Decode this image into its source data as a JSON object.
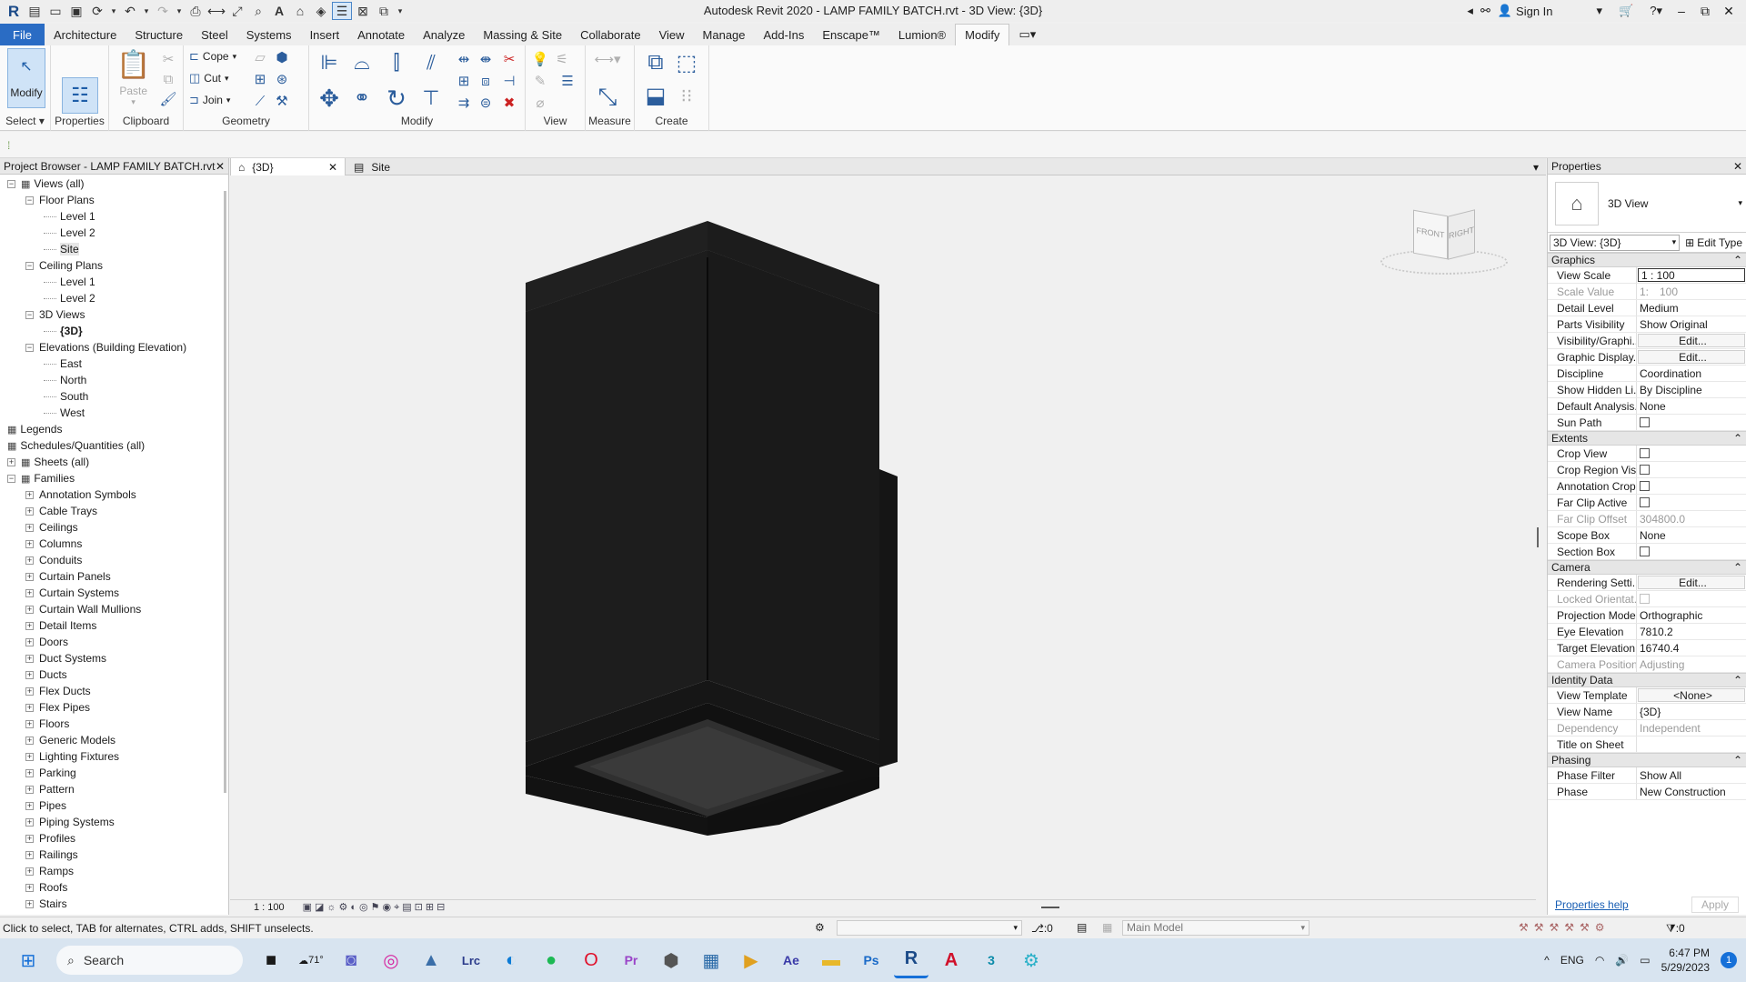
{
  "app": {
    "title": "Autodesk Revit 2020 - LAMP FAMILY BATCH.rvt - 3D View: {3D}",
    "sign_in": "Sign In"
  },
  "menu": [
    "File",
    "Architecture",
    "Structure",
    "Steel",
    "Systems",
    "Insert",
    "Annotate",
    "Analyze",
    "Massing & Site",
    "Collaborate",
    "View",
    "Manage",
    "Add-Ins",
    "Enscape™",
    "Lumion®",
    "Modify"
  ],
  "ribbon": {
    "select": "Select",
    "modify": "Modify",
    "properties": "Properties",
    "paste": "Paste",
    "clipboard": "Clipboard",
    "cope": "Cope",
    "cut": "Cut",
    "join": "Join",
    "geometry": "Geometry",
    "modify_panel": "Modify",
    "view": "View",
    "measure": "Measure",
    "create": "Create"
  },
  "project_browser": {
    "title": "Project Browser - LAMP FAMILY BATCH.rvt",
    "items": [
      {
        "label": "Views (all)",
        "level": 0,
        "toggle": "−",
        "icon": "views-icon"
      },
      {
        "label": "Floor Plans",
        "level": 1,
        "toggle": "−"
      },
      {
        "label": "Level 1",
        "level": 2
      },
      {
        "label": "Level 2",
        "level": 2
      },
      {
        "label": "Site",
        "level": 2,
        "selected": true
      },
      {
        "label": "Ceiling Plans",
        "level": 1,
        "toggle": "−"
      },
      {
        "label": "Level 1",
        "level": 2
      },
      {
        "label": "Level 2",
        "level": 2
      },
      {
        "label": "3D Views",
        "level": 1,
        "toggle": "−"
      },
      {
        "label": "{3D}",
        "level": 2,
        "bold": true
      },
      {
        "label": "Elevations (Building Elevation)",
        "level": 1,
        "toggle": "−"
      },
      {
        "label": "East",
        "level": 2
      },
      {
        "label": "North",
        "level": 2
      },
      {
        "label": "South",
        "level": 2
      },
      {
        "label": "West",
        "level": 2
      },
      {
        "label": "Legends",
        "level": 0,
        "icon": "legends-icon"
      },
      {
        "label": "Schedules/Quantities (all)",
        "level": 0,
        "icon": "schedules-icon"
      },
      {
        "label": "Sheets (all)",
        "level": 0,
        "toggle": "+",
        "icon": "sheets-icon"
      },
      {
        "label": "Families",
        "level": 0,
        "toggle": "−",
        "icon": "families-icon"
      },
      {
        "label": "Annotation Symbols",
        "level": 1,
        "toggle": "+"
      },
      {
        "label": "Cable Trays",
        "level": 1,
        "toggle": "+"
      },
      {
        "label": "Ceilings",
        "level": 1,
        "toggle": "+"
      },
      {
        "label": "Columns",
        "level": 1,
        "toggle": "+"
      },
      {
        "label": "Conduits",
        "level": 1,
        "toggle": "+"
      },
      {
        "label": "Curtain Panels",
        "level": 1,
        "toggle": "+"
      },
      {
        "label": "Curtain Systems",
        "level": 1,
        "toggle": "+"
      },
      {
        "label": "Curtain Wall Mullions",
        "level": 1,
        "toggle": "+"
      },
      {
        "label": "Detail Items",
        "level": 1,
        "toggle": "+"
      },
      {
        "label": "Doors",
        "level": 1,
        "toggle": "+"
      },
      {
        "label": "Duct Systems",
        "level": 1,
        "toggle": "+"
      },
      {
        "label": "Ducts",
        "level": 1,
        "toggle": "+"
      },
      {
        "label": "Flex Ducts",
        "level": 1,
        "toggle": "+"
      },
      {
        "label": "Flex Pipes",
        "level": 1,
        "toggle": "+"
      },
      {
        "label": "Floors",
        "level": 1,
        "toggle": "+"
      },
      {
        "label": "Generic Models",
        "level": 1,
        "toggle": "+"
      },
      {
        "label": "Lighting Fixtures",
        "level": 1,
        "toggle": "+"
      },
      {
        "label": "Parking",
        "level": 1,
        "toggle": "+"
      },
      {
        "label": "Pattern",
        "level": 1,
        "toggle": "+"
      },
      {
        "label": "Pipes",
        "level": 1,
        "toggle": "+"
      },
      {
        "label": "Piping Systems",
        "level": 1,
        "toggle": "+"
      },
      {
        "label": "Profiles",
        "level": 1,
        "toggle": "+"
      },
      {
        "label": "Railings",
        "level": 1,
        "toggle": "+"
      },
      {
        "label": "Ramps",
        "level": 1,
        "toggle": "+"
      },
      {
        "label": "Roofs",
        "level": 1,
        "toggle": "+"
      },
      {
        "label": "Stairs",
        "level": 1,
        "toggle": "+"
      }
    ]
  },
  "tabs": [
    {
      "label": "{3D}",
      "active": true
    },
    {
      "label": "Site",
      "active": false
    }
  ],
  "viewcube": {
    "front": "FRONT",
    "right": "RIGHT"
  },
  "view_scale_label": "1 : 100",
  "properties": {
    "title": "Properties",
    "type_name": "3D View",
    "selector": "3D View: {3D}",
    "edit_type": "Edit Type",
    "sections": [
      {
        "name": "Graphics",
        "rows": [
          {
            "k": "View Scale",
            "v": "1 : 100",
            "style": "box"
          },
          {
            "k": "Scale Value",
            "v": "100",
            "prefix": "1:",
            "disabled": true
          },
          {
            "k": "Detail Level",
            "v": "Medium"
          },
          {
            "k": "Parts Visibility",
            "v": "Show Original"
          },
          {
            "k": "Visibility/Graphi...",
            "v": "Edit...",
            "style": "btn"
          },
          {
            "k": "Graphic Display...",
            "v": "Edit...",
            "style": "btn"
          },
          {
            "k": "Discipline",
            "v": "Coordination"
          },
          {
            "k": "Show Hidden Li...",
            "v": "By Discipline"
          },
          {
            "k": "Default Analysis...",
            "v": "None"
          },
          {
            "k": "Sun Path",
            "v": "",
            "check": true
          }
        ]
      },
      {
        "name": "Extents",
        "rows": [
          {
            "k": "Crop View",
            "v": "",
            "check": true
          },
          {
            "k": "Crop Region Vis...",
            "v": "",
            "check": true
          },
          {
            "k": "Annotation Crop",
            "v": "",
            "check": true
          },
          {
            "k": "Far Clip Active",
            "v": "",
            "check": true
          },
          {
            "k": "Far Clip Offset",
            "v": "304800.0",
            "disabled": true
          },
          {
            "k": "Scope Box",
            "v": "None"
          },
          {
            "k": "Section Box",
            "v": "",
            "check": true
          }
        ]
      },
      {
        "name": "Camera",
        "rows": [
          {
            "k": "Rendering Setti...",
            "v": "Edit...",
            "style": "btn"
          },
          {
            "k": "Locked Orientat...",
            "v": "",
            "check": true,
            "disabled": true
          },
          {
            "k": "Projection Mode",
            "v": "Orthographic"
          },
          {
            "k": "Eye Elevation",
            "v": "7810.2"
          },
          {
            "k": "Target Elevation",
            "v": "16740.4"
          },
          {
            "k": "Camera Position",
            "v": "Adjusting",
            "disabled": true
          }
        ]
      },
      {
        "name": "Identity Data",
        "rows": [
          {
            "k": "View Template",
            "v": "<None>",
            "style": "btn"
          },
          {
            "k": "View Name",
            "v": "{3D}"
          },
          {
            "k": "Dependency",
            "v": "Independent",
            "disabled": true
          },
          {
            "k": "Title on Sheet",
            "v": ""
          }
        ]
      },
      {
        "name": "Phasing",
        "rows": [
          {
            "k": "Phase Filter",
            "v": "Show All"
          },
          {
            "k": "Phase",
            "v": "New Construction"
          }
        ]
      }
    ],
    "help": "Properties help",
    "apply": "Apply"
  },
  "status": {
    "message": "Click to select, TAB for alternates, CTRL adds, SHIFT unselects.",
    "zero": ":0",
    "model": "Main Model",
    "filter": ":0"
  },
  "taskbar": {
    "search": "Search",
    "weather": "71°",
    "lang": "ENG",
    "time": "6:47 PM",
    "date": "5/29/2023",
    "notif": "1"
  }
}
